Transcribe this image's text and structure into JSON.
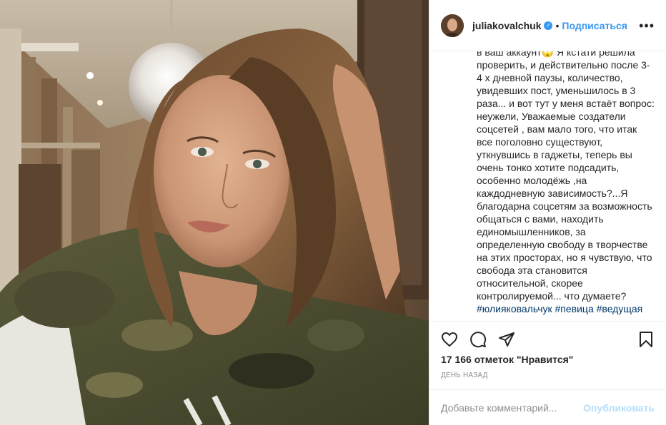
{
  "post": {
    "username": "juliakovalchuk",
    "separator": "•",
    "follow_label": "Подписаться",
    "more_label": "•••",
    "caption_text": "в ваш аккаунт🙄 Я кстати решила проверить, и действительно после 3-4 х дневной паузы, количество, увидевших пост, уменьшилось в 3 раза... и вот тут у меня встаёт вопрос: неужели, Уважаемые создатели соцсетей , вам мало того, что итак все поголовно существуют, уткнувшись в гаджеты, теперь вы очень тонко хотите подсадить, особенно молодёжь ,на каждодневную зависимость?...Я благодарна соцсетям за возможность общаться с вами, находить единомышленников, за определенную свободу в творчестве на этих просторах, но я чувствую, что свобода эта становится относительной, скорее контролируемой... что думаете?",
    "caption_tags": "#юлияковальчук #певица #ведущая",
    "likes": "17 166 отметок \"Нравится\"",
    "time_ago": "день назад",
    "comment_placeholder": "Добавьте комментарий...",
    "publish_label": "Опубликовать"
  },
  "icons": {
    "verified": "verified-badge-icon",
    "like": "heart-icon",
    "comment": "comment-icon",
    "share": "paper-plane-icon",
    "save": "bookmark-icon"
  },
  "colors": {
    "link_blue": "#3897f0",
    "publish_disabled": "#b2dffc",
    "muted": "#8e8e8e",
    "text": "#262626"
  }
}
